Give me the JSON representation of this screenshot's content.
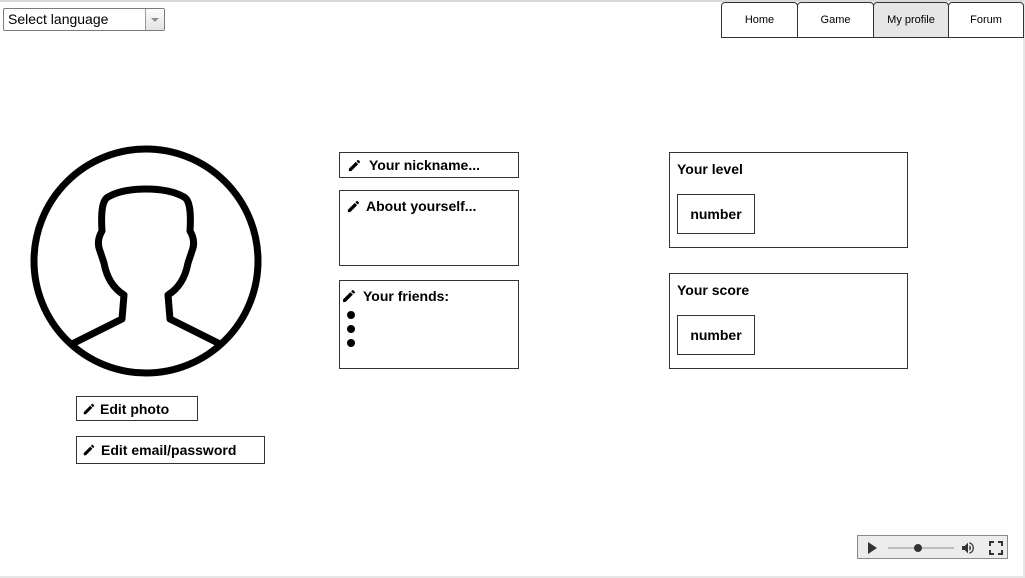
{
  "language_select": {
    "value": "Select language"
  },
  "nav": {
    "tabs": [
      {
        "label": "Home"
      },
      {
        "label": "Game"
      },
      {
        "label": "My profile",
        "active": true
      },
      {
        "label": "Forum"
      }
    ]
  },
  "profile": {
    "avatar_icon": "user-silhouette-icon",
    "edit_photo_label": "Edit photo",
    "edit_credentials_label": "Edit email/password",
    "nickname_placeholder": "Your nickname...",
    "about_placeholder": "About yourself...",
    "friends_label": "Your friends:",
    "friends": [
      "",
      "",
      ""
    ]
  },
  "stats": {
    "level": {
      "label": "Your level",
      "value": "number"
    },
    "score": {
      "label": "Your score",
      "value": "number"
    }
  },
  "media_player": {
    "icons": [
      "play-icon",
      "volume-icon",
      "fullscreen-icon"
    ]
  }
}
